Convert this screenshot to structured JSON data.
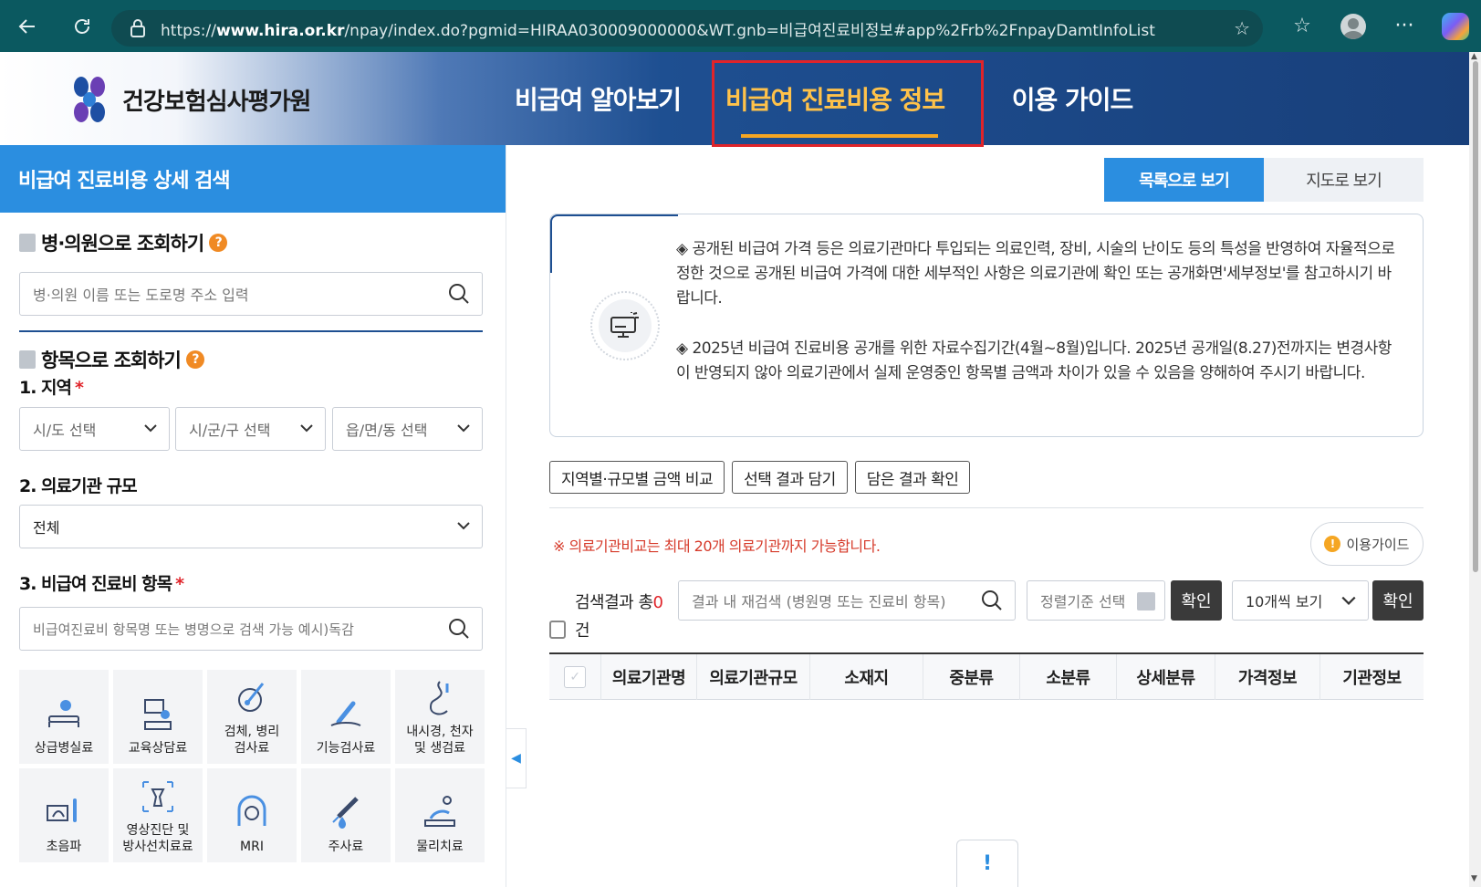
{
  "browser": {
    "url_prefix": "https://",
    "url_domain": "www.hira.or.kr",
    "url_path": "/npay/index.do?pgmid=HIRAA030009000000&WT.gnb=비급여진료비정보#app%2Frb%2FnpayDamtInfoList"
  },
  "site": {
    "org_name": "건강보험심사평가원",
    "nav": [
      {
        "label": "비급여 알아보기"
      },
      {
        "label": "비급여 진료비용 정보"
      },
      {
        "label": "이용 가이드"
      }
    ],
    "active_nav_index": 1
  },
  "left": {
    "title": "비급여 진료비용 상세 검색",
    "hospital_section": {
      "heading": "병·의원으로 조회하기",
      "placeholder": "병·의원 이름 또는 도로명 주소 입력"
    },
    "item_section": {
      "heading": "항목으로 조회하기",
      "region_label": "1. 지역",
      "region_selects": [
        "시/도 선택",
        "시/군/구 선택",
        "읍/면/동 선택"
      ],
      "scale_label": "2. 의료기관 규모",
      "scale_value": "전체",
      "item_label": "3. 비급여 진료비 항목",
      "item_placeholder": "비급여진료비 항목명 또는 병명으로 검색 가능 예시)독감"
    },
    "categories": [
      {
        "line1": "상급병실료",
        "line2": "",
        "icon": "hospital-bed-icon"
      },
      {
        "line1": "교육상담료",
        "line2": "",
        "icon": "counseling-icon"
      },
      {
        "line1": "검체, 병리",
        "line2": "검사료",
        "icon": "pathology-test-icon"
      },
      {
        "line1": "기능검사료",
        "line2": "",
        "icon": "function-test-icon"
      },
      {
        "line1": "내시경, 천자",
        "line2": "및 생검료",
        "icon": "endoscope-icon"
      },
      {
        "line1": "초음파",
        "line2": "",
        "icon": "ultrasound-icon"
      },
      {
        "line1": "영상진단 및",
        "line2": "방사선치료료",
        "icon": "radiology-icon"
      },
      {
        "line1": "MRI",
        "line2": "",
        "icon": "mri-icon"
      },
      {
        "line1": "주사료",
        "line2": "",
        "icon": "syringe-icon"
      },
      {
        "line1": "물리치료",
        "line2": "",
        "icon": "physical-therapy-icon"
      }
    ]
  },
  "right": {
    "view_list": "목록으로 보기",
    "view_map": "지도로 보기",
    "notice_1": "◈ 공개된 비급여 가격 등은 의료기관마다 투입되는 의료인력, 장비, 시술의 난이도 등의 특성을 반영하여 자율적으로 정한 것으로 공개된 비급여 가격에 대한 세부적인 사항은 의료기관에 확인 또는 공개화면'세부정보'를 참고하시기 바랍니다.",
    "notice_2": "◈ 2025년 비급여 진료비용 공개를 위한 자료수집기간(4월~8월)입니다. 2025년 공개일(8.27)전까지는 변경사항이 반영되지 않아 의료기관에서 실제 운영중인 항목별 금액과 차이가 있을 수 있음을 양해하여 주시기 바랍니다.",
    "actions": [
      "지역별·규모별 금액 비교",
      "선택 결과 담기",
      "담은 결과 확인"
    ],
    "warning": "※ 의료기관비교는 최대 20개 의료기관까지 가능합니다.",
    "guide": "이용가이드",
    "result_label": "검색결과 총",
    "result_count": "0",
    "result_unit": "건",
    "re_search_placeholder": "결과 내 재검색 (병원명 또는 진료비 항목)",
    "sort_placeholder": "정렬기준 선택",
    "confirm": "확인",
    "page_size": "10개씩 보기",
    "columns": [
      "의료기관명",
      "의료기관규모",
      "소재지",
      "중분류",
      "소분류",
      "상세분류",
      "가격정보",
      "기관정보"
    ],
    "alert_symbol": "!"
  }
}
